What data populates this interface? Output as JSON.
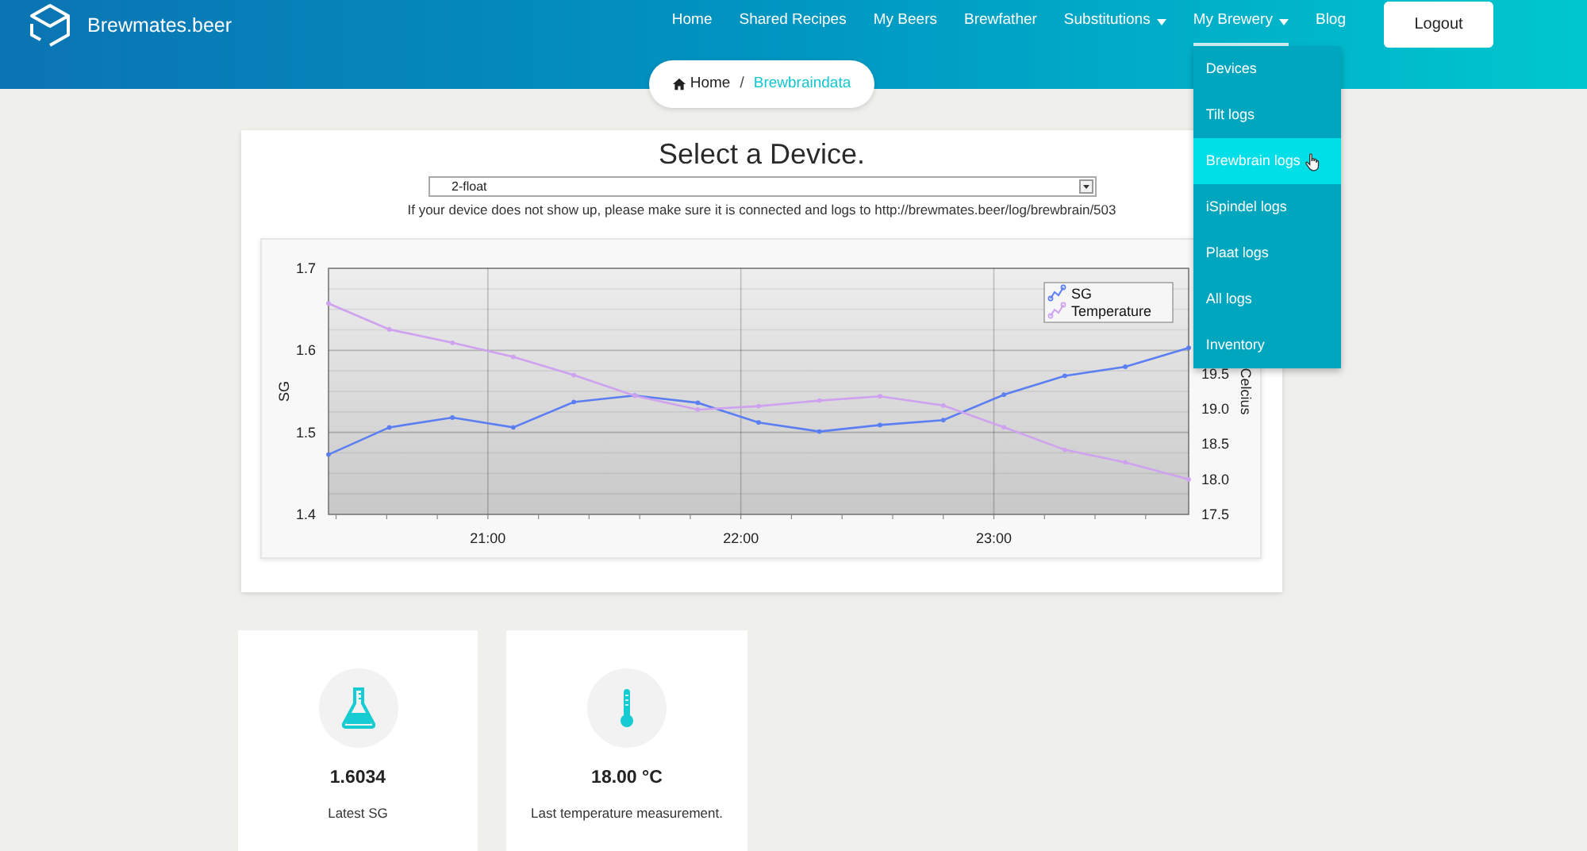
{
  "header": {
    "brand": "Brewmates.beer",
    "nav": [
      {
        "label": "Home",
        "dropdown": false,
        "selected": false
      },
      {
        "label": "Shared Recipes",
        "dropdown": false,
        "selected": false
      },
      {
        "label": "My Beers",
        "dropdown": false,
        "selected": false
      },
      {
        "label": "Brewfather",
        "dropdown": false,
        "selected": false
      },
      {
        "label": "Substitutions",
        "dropdown": true,
        "selected": false
      },
      {
        "label": "My Brewery",
        "dropdown": true,
        "selected": true,
        "menu": [
          {
            "label": "Devices",
            "selected": false
          },
          {
            "label": "Tilt logs",
            "selected": false
          },
          {
            "label": "Brewbrain logs",
            "selected": true
          },
          {
            "label": "iSpindel logs",
            "selected": false
          },
          {
            "label": "Plaat logs",
            "selected": false
          },
          {
            "label": "All logs",
            "selected": false
          },
          {
            "label": "Inventory",
            "selected": false
          }
        ]
      },
      {
        "label": "Blog",
        "dropdown": false,
        "selected": false
      }
    ],
    "logout_button": "Logout"
  },
  "breadcrumb": [
    {
      "label": "Home",
      "kind": "home"
    },
    {
      "label": "/",
      "kind": "separator"
    },
    {
      "label": "Brewbraindata",
      "kind": "current"
    }
  ],
  "device_panel": {
    "title": "Select a Device.",
    "select": {
      "value": "2-float"
    },
    "help_text": "If your device does not show up, please make sure it is connected and logs to http://brewmates.beer/log/brewbrain/503",
    "chart_data": {
      "type": "line",
      "ylabel": "SG",
      "y2label": "Celcius",
      "x": [
        20.37,
        20.61,
        20.86,
        21.1,
        21.34,
        21.58,
        21.83,
        22.07,
        22.31,
        22.55,
        22.8,
        23.04,
        23.28,
        23.52,
        23.77
      ],
      "xlim": [
        20.37,
        23.77
      ],
      "xticks": [
        {
          "value": 21,
          "label": "21:00"
        },
        {
          "value": 22,
          "label": "22:00"
        },
        {
          "value": 23,
          "label": "23:00"
        }
      ],
      "ylim": [
        1.4,
        1.7
      ],
      "yticks": [
        1.4,
        1.5,
        1.6,
        1.7
      ],
      "y2lim": [
        17.5,
        21.0
      ],
      "y2ticks": [
        17.5,
        {
          "value": 18,
          "label": "18.0"
        },
        18.5,
        {
          "value": 19,
          "label": "19.0"
        },
        19.5
      ],
      "grid": true,
      "legend": "upper right",
      "series": [
        {
          "name": "SG",
          "color": "#5b7ff2",
          "values": [
            1.473,
            1.506,
            1.518,
            1.506,
            1.537,
            1.545,
            1.536,
            1.512,
            1.501,
            1.509,
            1.515,
            1.546,
            1.569,
            1.58,
            1.603
          ]
        },
        {
          "name": "Temperature",
          "color": "#cfa2f0",
          "axis": "y2",
          "values": [
            20.5,
            20.13,
            19.94,
            19.74,
            19.48,
            19.19,
            18.99,
            19.04,
            19.12,
            19.18,
            19.05,
            18.74,
            18.42,
            18.24,
            18.0
          ]
        }
      ]
    }
  },
  "stats": [
    {
      "kind": "gravity",
      "value": "1.6034",
      "label": "Latest SG"
    },
    {
      "kind": "temperature",
      "value": "18.00 °C",
      "label": "Last temperature measurement."
    }
  ]
}
